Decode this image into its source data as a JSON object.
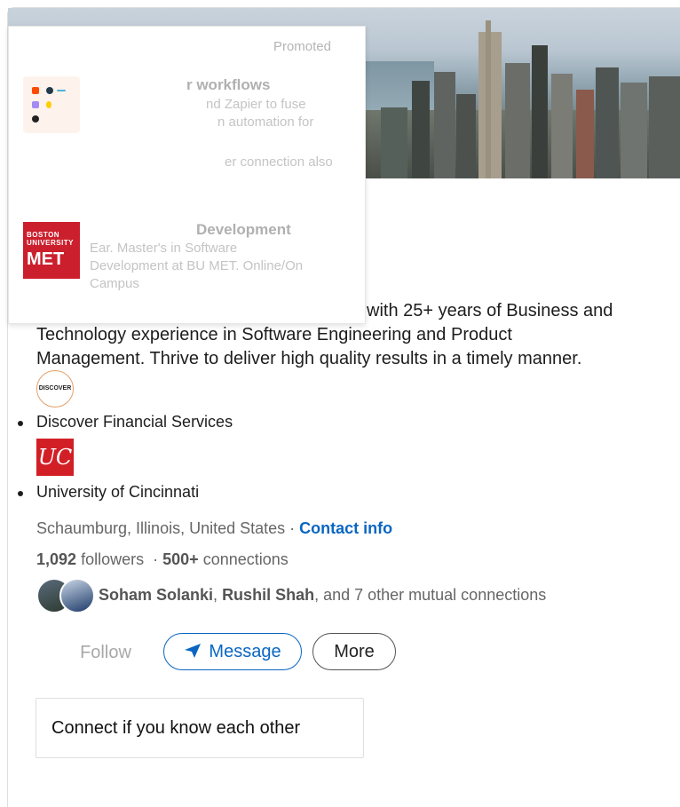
{
  "ads": {
    "promoted_label": "Promoted",
    "ad1": {
      "title": "r workflows",
      "lines": [
        "nd Zapier to fuse",
        "n automation for",
        "er connection also"
      ]
    },
    "ad2": {
      "logo_small_line1": "BOSTON",
      "logo_small_line2": "UNIVERSITY",
      "logo_big": "MET",
      "title": "Development",
      "lines": [
        "Ear. Master's in Software",
        "Development at BU MET. Online/On",
        "Campus"
      ]
    }
  },
  "profile": {
    "summary_line1": "with 25+ years of Business and",
    "summary_line2": "Technology experience in Software Engineering and Product",
    "summary_line3": "Management. Thrive to deliver high quality results in a timely manner.",
    "experience": [
      {
        "logo_text": "DISCOVER",
        "name": "Discover Financial Services"
      },
      {
        "logo_text": "UC",
        "name": "University of Cincinnati"
      }
    ],
    "location": "Schaumburg, Illinois, United States",
    "location_sep": " · ",
    "contact_info": "Contact info",
    "followers_count": "1,092",
    "followers_label": "followers",
    "connections_sep": "·",
    "connections_count": "500+",
    "connections_label": "connections",
    "mutual": {
      "name1": "Soham Solanki",
      "sep": ", ",
      "name2": "Rushil Shah",
      "rest": ", and 7 other mutual connections"
    }
  },
  "actions": {
    "follow_label": "Follow",
    "message_label": "Message",
    "more_label": "More"
  },
  "connect_prompt": "Connect if you know each other",
  "colors": {
    "accent": "#0a66c2",
    "uc_red": "#d21f26",
    "bu_red": "#cc1f2d"
  }
}
